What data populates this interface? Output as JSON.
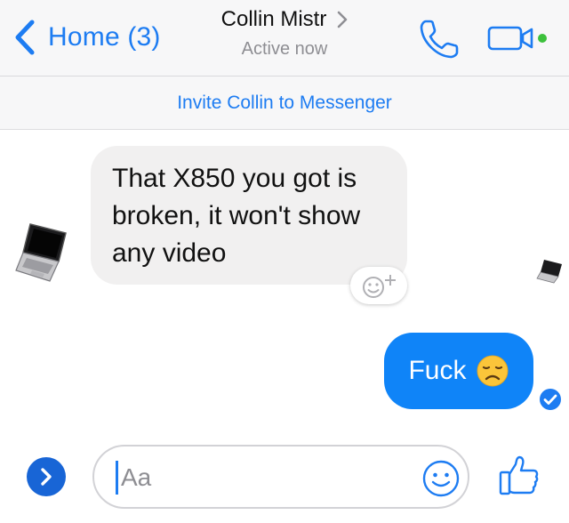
{
  "header": {
    "back_label": "Home (3)",
    "contact_name": "Collin Mistr",
    "status": "Active now"
  },
  "invite": {
    "label": "Invite Collin to Messenger"
  },
  "messages": [
    {
      "direction": "incoming",
      "text": "That X850 you got is broken, it won't show any video"
    },
    {
      "direction": "outgoing",
      "text": "Fuck",
      "emoji": "disappointed-face"
    }
  ],
  "composer": {
    "placeholder": "Aa",
    "value": ""
  },
  "icons": {
    "back": "chevron-left-icon",
    "title_chevron": "chevron-right-icon",
    "call": "phone-icon",
    "video": "video-camera-icon",
    "react": "add-reaction-icon",
    "expand": "chevron-right-icon",
    "emoji": "smiley-icon",
    "like": "thumbs-up-icon",
    "delivered": "checkmark-icon"
  },
  "colors": {
    "accent": "#1d7cf2",
    "outgoing_bubble": "#0f84f8",
    "incoming_bubble": "#f1f0f0",
    "online_dot": "#3dc13c"
  }
}
